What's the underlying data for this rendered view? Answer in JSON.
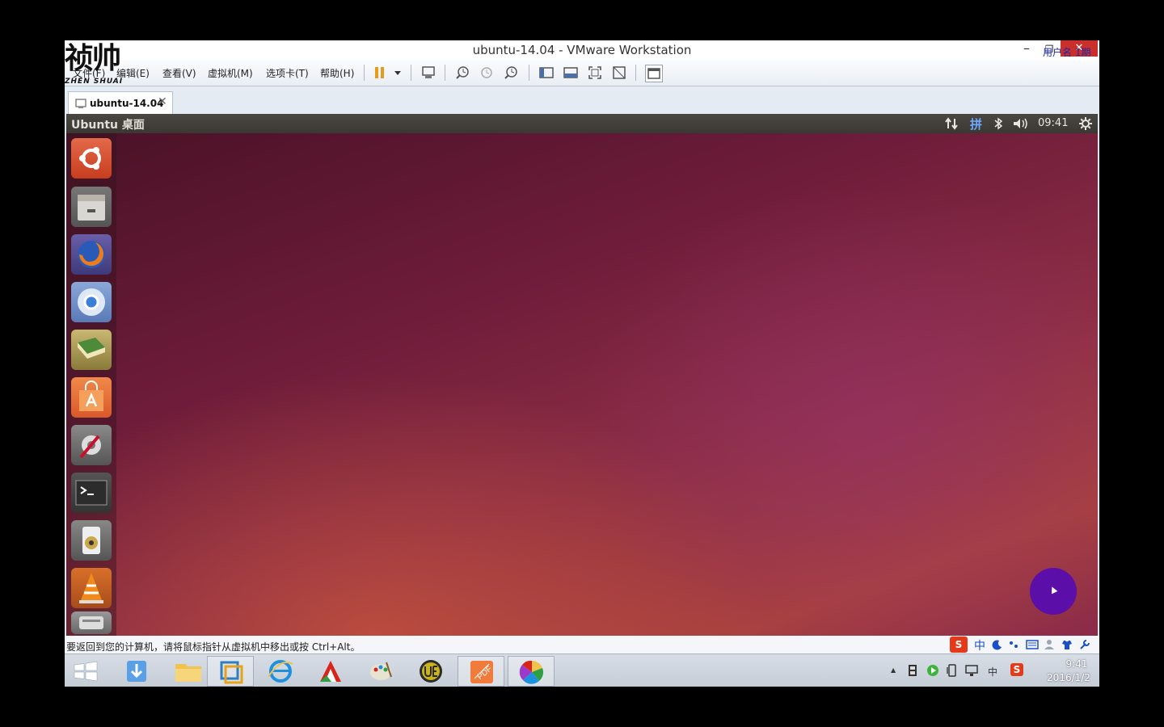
{
  "window": {
    "title": "ubuntu-14.04 - VMware Workstation",
    "user_label": "用户名 1期",
    "min": "–",
    "max": "❐",
    "close": "✕"
  },
  "logo": {
    "main": "祯帅",
    "sub": "ZHEN SHUAI"
  },
  "menu": {
    "items": [
      "文件(F)",
      "编辑(E)",
      "查看(V)",
      "虚拟机(M)",
      "选项卡(T)",
      "帮助(H)"
    ]
  },
  "tab": {
    "label": "ubuntu-14.04",
    "close": "✕"
  },
  "ubuntu": {
    "panel_title": "Ubuntu 桌面",
    "time": "09:41",
    "input_method": "拼",
    "launcher_apps": [
      "dash-home",
      "files",
      "firefox",
      "chromium",
      "books",
      "software-center",
      "system-settings",
      "terminal",
      "speaker",
      "vlc",
      "more"
    ]
  },
  "status": {
    "text": "要返回到您的计算机，请将鼠标指针从虚拟机中移出或按 Ctrl+Alt。"
  },
  "ime": {
    "zh": "中",
    "sogou": "S"
  },
  "taskbar": {
    "time": "9:41",
    "date": "2016/1/2",
    "tray_zh": "中",
    "tray_arrow": "▲",
    "apps": [
      "start",
      "download",
      "explorer",
      "vmware",
      "ie",
      "app-red",
      "paint",
      "ultraedit",
      "pdf",
      "pinwheel"
    ]
  },
  "colors": {
    "ubuntu_panel": "#3f3d38",
    "vm_close": "#c9302c",
    "cursor_ring": "#5b0fa8",
    "user_label": "#1a2aa8"
  }
}
